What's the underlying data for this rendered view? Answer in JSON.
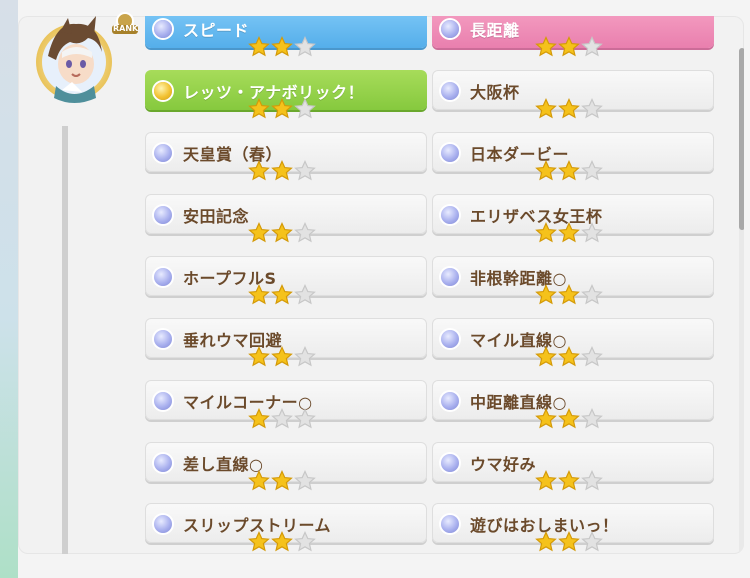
{
  "panel": {
    "avatar": {
      "badge_text": "RANK"
    },
    "skills": [
      {
        "name": "スピード",
        "style": "blue",
        "stars": 2,
        "dot": "silver"
      },
      {
        "name": "長距離",
        "style": "pink",
        "stars": 2,
        "dot": "silver"
      },
      {
        "name": "レッツ・アナボリック！",
        "style": "green",
        "stars": 2,
        "dot": "gold"
      },
      {
        "name": "大阪杯",
        "style": "plain",
        "stars": 2,
        "dot": "silver"
      },
      {
        "name": "天皇賞（春）",
        "style": "plain",
        "stars": 2,
        "dot": "silver"
      },
      {
        "name": "日本ダービー",
        "style": "plain",
        "stars": 2,
        "dot": "silver"
      },
      {
        "name": "安田記念",
        "style": "plain",
        "stars": 2,
        "dot": "silver"
      },
      {
        "name": "エリザベス女王杯",
        "style": "plain",
        "stars": 2,
        "dot": "silver"
      },
      {
        "name": "ホープフルS",
        "style": "plain",
        "stars": 2,
        "dot": "silver"
      },
      {
        "name": "非根幹距離○",
        "style": "plain",
        "stars": 2,
        "dot": "silver"
      },
      {
        "name": "垂れウマ回避",
        "style": "plain",
        "stars": 2,
        "dot": "silver"
      },
      {
        "name": "マイル直線○",
        "style": "plain",
        "stars": 2,
        "dot": "silver"
      },
      {
        "name": "マイルコーナー○",
        "style": "plain",
        "stars": 1,
        "dot": "silver"
      },
      {
        "name": "中距離直線○",
        "style": "plain",
        "stars": 2,
        "dot": "silver"
      },
      {
        "name": "差し直線○",
        "style": "plain",
        "stars": 2,
        "dot": "silver"
      },
      {
        "name": "ウマ好み",
        "style": "plain",
        "stars": 2,
        "dot": "silver"
      },
      {
        "name": "スリップストリーム",
        "style": "plain",
        "stars": 2,
        "dot": "silver"
      },
      {
        "name": "遊びはおしまいっ！",
        "style": "plain",
        "stars": 2,
        "dot": "silver"
      }
    ],
    "max_stars": 3,
    "colors": {
      "star_filled": "#f5c21b",
      "star_empty": "#e2e2e2",
      "blue": "#55aeea",
      "pink": "#e97fae",
      "green": "#86c93e",
      "text": "#6b4a2b"
    }
  }
}
